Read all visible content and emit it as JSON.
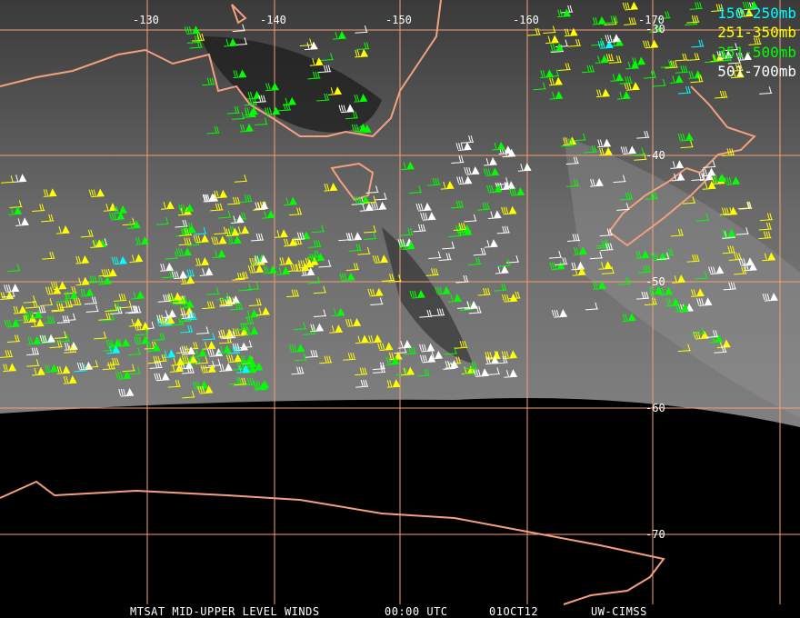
{
  "map": {
    "longitude_labels": [
      "-130",
      "-140",
      "-150",
      "-160",
      "-170"
    ],
    "latitude_labels": [
      "-30",
      "-40",
      "-50",
      "-60",
      "-70"
    ],
    "grid_color": "#f0a078",
    "coast_color": "#f4a080"
  },
  "legend": [
    {
      "label": "150-250mb",
      "color": "#00ffff"
    },
    {
      "label": "251-350mb",
      "color": "#ffff00"
    },
    {
      "label": "351-500mb",
      "color": "#00ff00"
    },
    {
      "label": "501-700mb",
      "color": "#ffffff"
    }
  ],
  "caption": {
    "product": "MTSAT MID-UPPER LEVEL WINDS",
    "time": "00:00 UTC",
    "date": "01OCT12",
    "source": "UW-CIMSS"
  }
}
